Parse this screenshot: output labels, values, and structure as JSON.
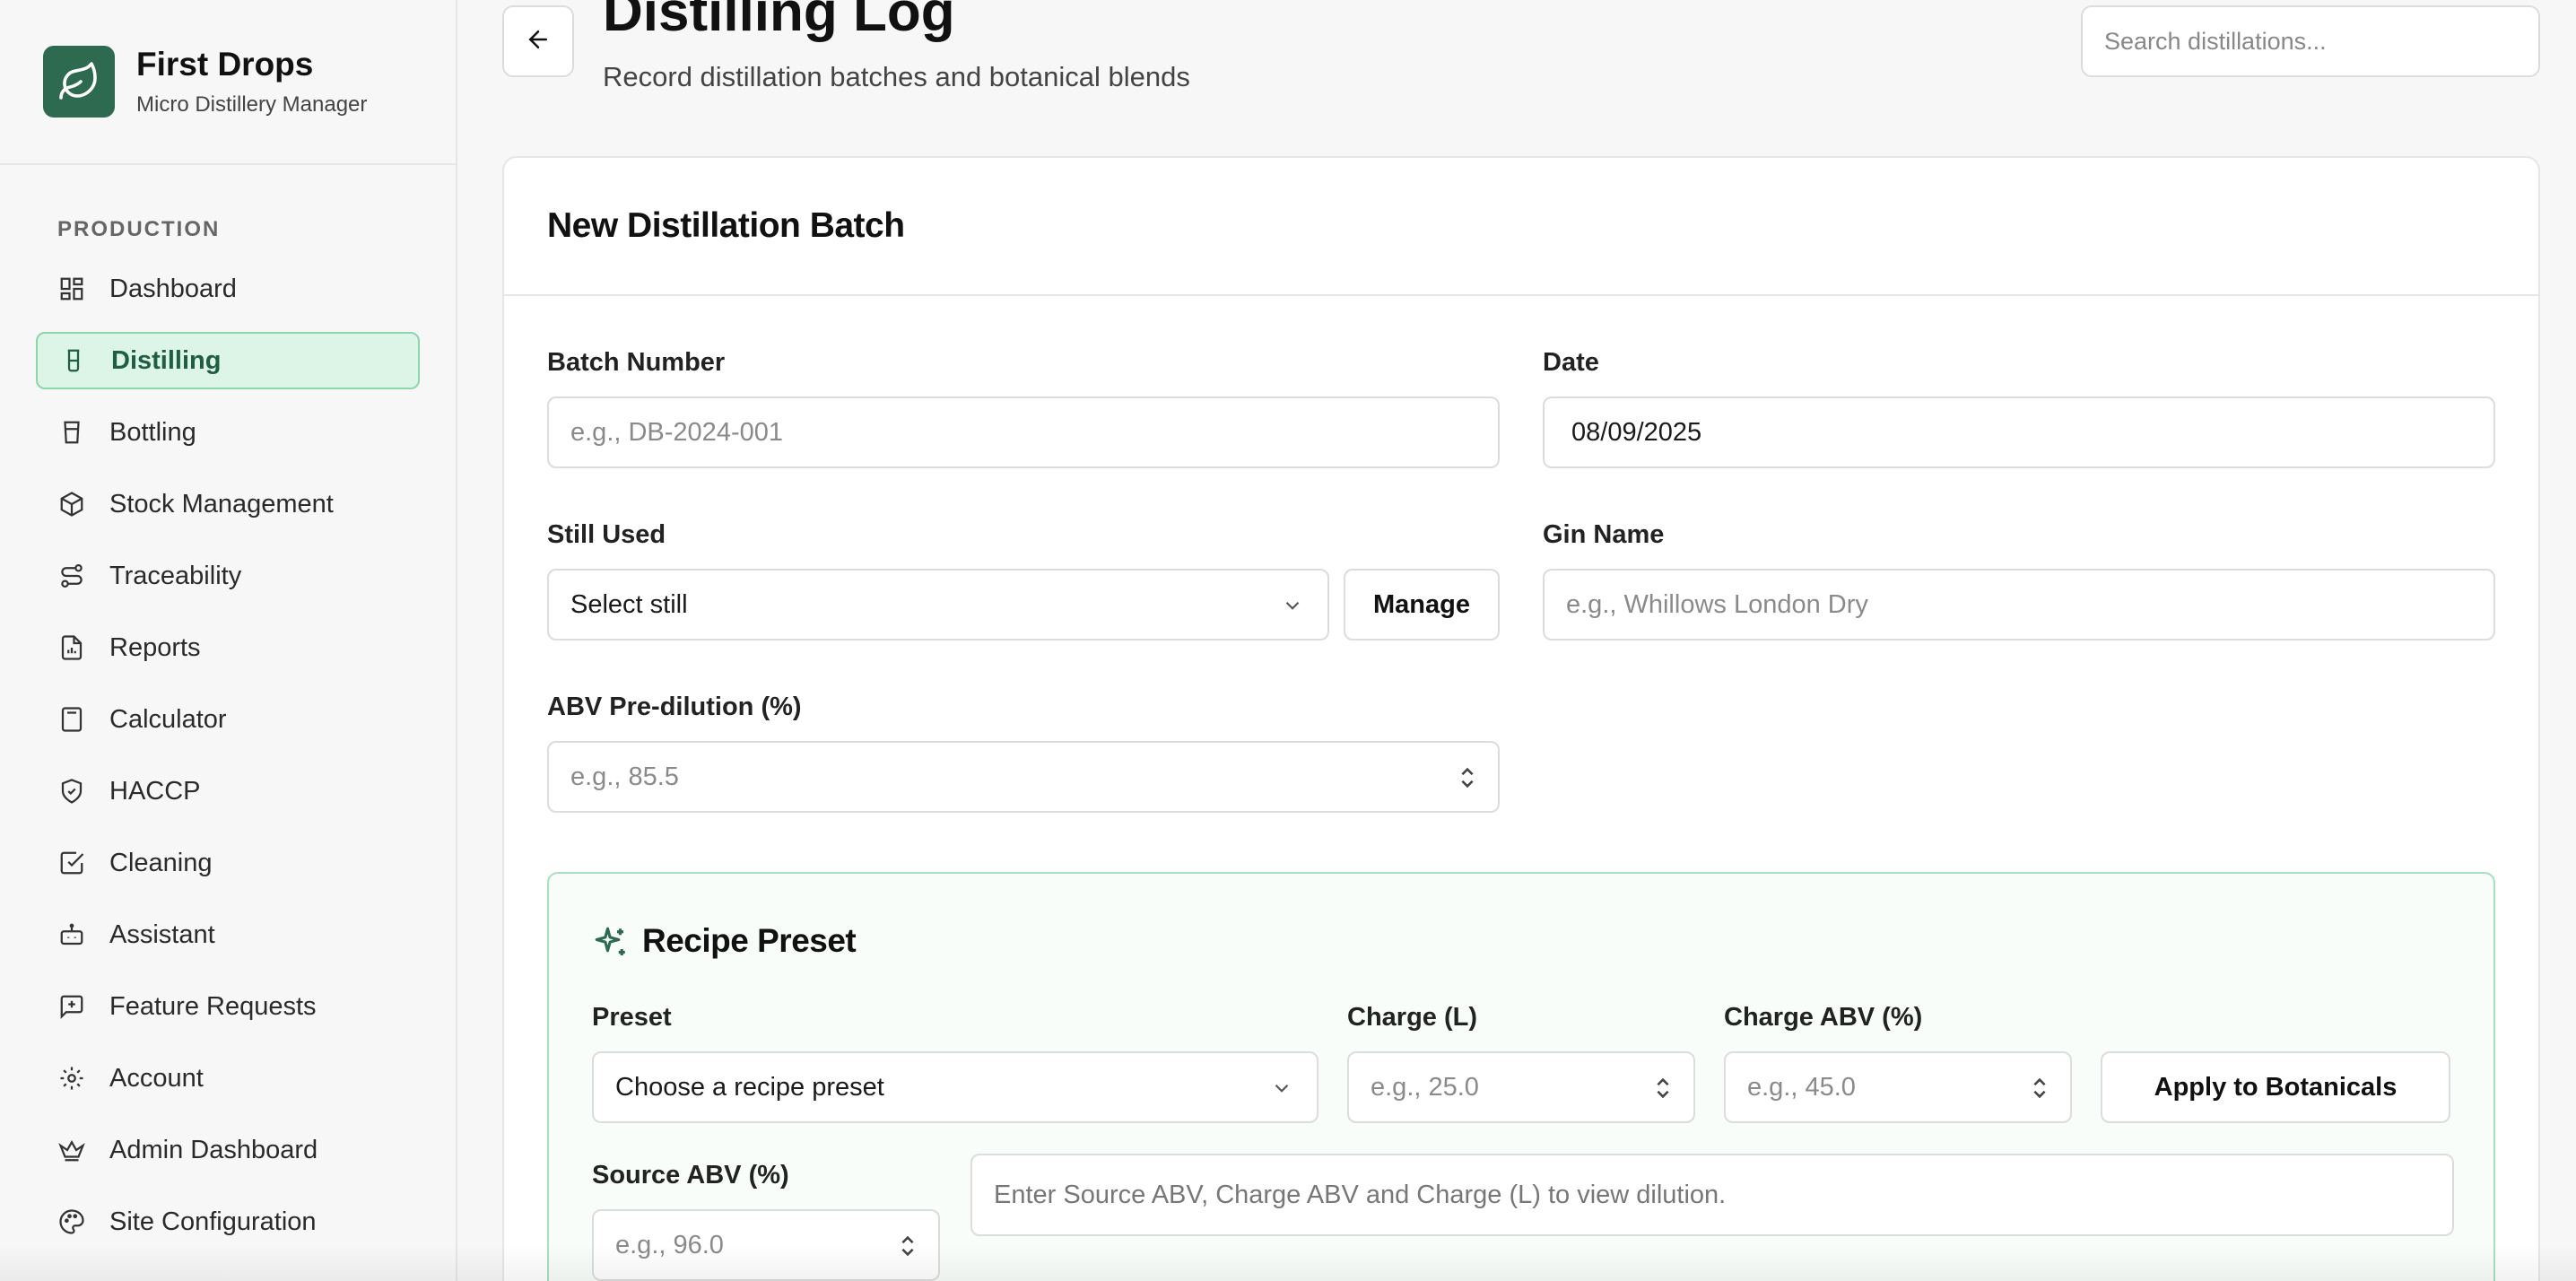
{
  "brand": {
    "name": "First Drops",
    "subtitle": "Micro Distillery Manager",
    "logo_icon": "leaf-icon"
  },
  "sidebar": {
    "section": "PRODUCTION",
    "items": [
      {
        "label": "Dashboard",
        "icon": "dashboard-icon",
        "active": false
      },
      {
        "label": "Distilling",
        "icon": "flask-icon",
        "active": true
      },
      {
        "label": "Bottling",
        "icon": "bottle-icon",
        "active": false
      },
      {
        "label": "Stock Management",
        "icon": "package-icon",
        "active": false
      },
      {
        "label": "Traceability",
        "icon": "route-icon",
        "active": false
      },
      {
        "label": "Reports",
        "icon": "file-icon",
        "active": false
      },
      {
        "label": "Calculator",
        "icon": "calculator-icon",
        "active": false
      },
      {
        "label": "HACCP",
        "icon": "shield-check-icon",
        "active": false
      },
      {
        "label": "Cleaning",
        "icon": "checkbox-icon",
        "active": false
      },
      {
        "label": "Assistant",
        "icon": "bot-icon",
        "active": false
      },
      {
        "label": "Feature Requests",
        "icon": "message-plus-icon",
        "active": false
      },
      {
        "label": "Account",
        "icon": "gear-icon",
        "active": false
      },
      {
        "label": "Admin Dashboard",
        "icon": "crown-icon",
        "active": false
      },
      {
        "label": "Site Configuration",
        "icon": "palette-icon",
        "active": false
      }
    ]
  },
  "header": {
    "title": "Distilling Log",
    "subtitle": "Record distillation batches and botanical blends",
    "search_placeholder": "Search distillations..."
  },
  "form": {
    "title": "New Distillation Batch",
    "batch_number": {
      "label": "Batch Number",
      "placeholder": "e.g., DB-2024-001"
    },
    "date": {
      "label": "Date",
      "value": "08/09/2025"
    },
    "still": {
      "label": "Still Used",
      "value": "Select still",
      "manage_label": "Manage"
    },
    "gin_name": {
      "label": "Gin Name",
      "placeholder": "e.g., Whillows London Dry"
    },
    "abv": {
      "label": "ABV Pre-dilution (%)",
      "placeholder": "e.g., 85.5"
    }
  },
  "recipe": {
    "title": "Recipe Preset",
    "preset": {
      "label": "Preset",
      "value": "Choose a recipe preset"
    },
    "charge": {
      "label": "Charge (L)",
      "placeholder": "e.g., 25.0"
    },
    "charge_abv": {
      "label": "Charge ABV (%)",
      "placeholder": "e.g., 45.0"
    },
    "apply_label": "Apply to Botanicals",
    "source_abv": {
      "label": "Source ABV (%)",
      "placeholder": "e.g., 96.0"
    },
    "dilution_hint": "Enter Source ABV, Charge ABV and Charge (L) to view dilution."
  },
  "colors": {
    "brand": "#2d6a4f",
    "active_bg": "#dcf5e6",
    "active_border": "#8ed6a9",
    "recipe_border": "#a8dfbf"
  }
}
